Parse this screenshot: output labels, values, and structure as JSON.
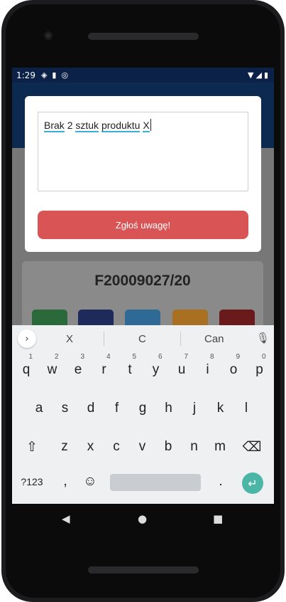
{
  "statusbar": {
    "time": "1:29",
    "icons_left": [
      "location-icon",
      "sd-card-icon",
      "sync-icon"
    ],
    "icons_right": [
      "wifi-icon",
      "signal-icon",
      "battery-icon"
    ]
  },
  "document": {
    "number": "F20009027/20"
  },
  "action_tiles": [
    {
      "name": "tile-green",
      "color": "#2a6a3a"
    },
    {
      "name": "tile-navy",
      "color": "#1e2a5a"
    },
    {
      "name": "tile-blue",
      "color": "#2f6a96"
    },
    {
      "name": "tile-orange",
      "color": "#a87020"
    },
    {
      "name": "tile-red",
      "color": "#6a1a1a"
    }
  ],
  "dialog": {
    "note_words": [
      "Brak",
      "2",
      "sztuk",
      "produktu",
      "X"
    ],
    "submit_label": "Zgłoś uwagę!",
    "submit_color": "#d95555"
  },
  "keyboard": {
    "suggestions": [
      "X",
      "C",
      "Can"
    ],
    "row1": [
      {
        "k": "q",
        "h": "1"
      },
      {
        "k": "w",
        "h": "2"
      },
      {
        "k": "e",
        "h": "3"
      },
      {
        "k": "r",
        "h": "4"
      },
      {
        "k": "t",
        "h": "5"
      },
      {
        "k": "y",
        "h": "6"
      },
      {
        "k": "u",
        "h": "7"
      },
      {
        "k": "i",
        "h": "8"
      },
      {
        "k": "o",
        "h": "9"
      },
      {
        "k": "p",
        "h": "0"
      }
    ],
    "row2": [
      "a",
      "s",
      "d",
      "f",
      "g",
      "h",
      "j",
      "k",
      "l"
    ],
    "row3": [
      "z",
      "x",
      "c",
      "v",
      "b",
      "n",
      "m"
    ],
    "symbols_label": "?123",
    "comma": ",",
    "period": ".",
    "accent_color": "#4bb5a6"
  }
}
